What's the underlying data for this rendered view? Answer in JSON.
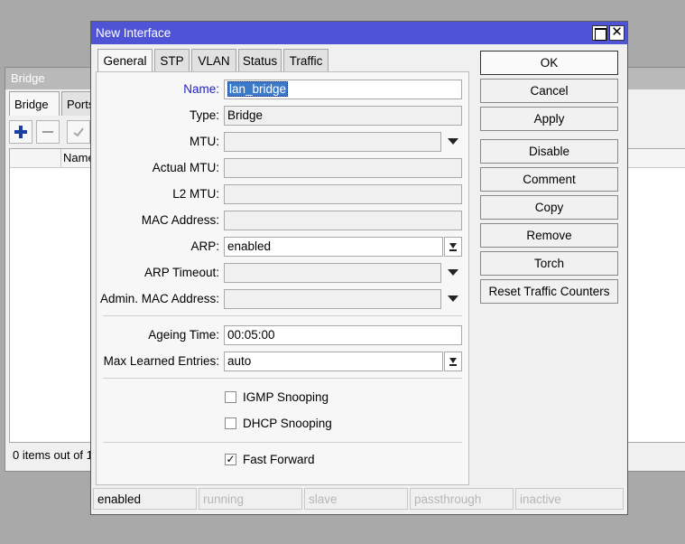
{
  "background_window": {
    "title": "Bridge",
    "tabs": [
      {
        "label": "Bridge",
        "active": true
      },
      {
        "label": "Ports",
        "active": false
      }
    ],
    "toolbar_icons": [
      "plus-icon",
      "minus-icon",
      "check-icon"
    ],
    "list_header": "Name",
    "status_text": "0 items out of 1"
  },
  "dialog": {
    "title": "New Interface",
    "tabs": [
      {
        "label": "General",
        "active": true
      },
      {
        "label": "STP",
        "active": false
      },
      {
        "label": "VLAN",
        "active": false
      },
      {
        "label": "Status",
        "active": false
      },
      {
        "label": "Traffic",
        "active": false
      }
    ],
    "fields": {
      "name": {
        "label": "Name:",
        "value": "lan_bridge"
      },
      "type": {
        "label": "Type:",
        "value": "Bridge"
      },
      "mtu": {
        "label": "MTU:",
        "value": ""
      },
      "actual_mtu": {
        "label": "Actual MTU:",
        "value": ""
      },
      "l2_mtu": {
        "label": "L2 MTU:",
        "value": ""
      },
      "mac_address": {
        "label": "MAC Address:",
        "value": ""
      },
      "arp": {
        "label": "ARP:",
        "value": "enabled"
      },
      "arp_timeout": {
        "label": "ARP Timeout:",
        "value": ""
      },
      "admin_mac": {
        "label": "Admin. MAC Address:",
        "value": ""
      },
      "ageing_time": {
        "label": "Ageing Time:",
        "value": "00:05:00"
      },
      "max_learned": {
        "label": "Max Learned Entries:",
        "value": "auto"
      }
    },
    "checkboxes": {
      "igmp": {
        "label": "IGMP Snooping",
        "checked": false
      },
      "dhcp": {
        "label": "DHCP Snooping",
        "checked": false
      },
      "fast_forward": {
        "label": "Fast Forward",
        "checked": true
      }
    },
    "buttons": {
      "ok": "OK",
      "cancel": "Cancel",
      "apply": "Apply",
      "disable": "Disable",
      "comment": "Comment",
      "copy": "Copy",
      "remove": "Remove",
      "torch": "Torch",
      "reset_traffic": "Reset Traffic Counters"
    },
    "status_bar": [
      "enabled",
      "running",
      "slave",
      "passthrough",
      "inactive"
    ]
  },
  "colors": {
    "title_bar": "#4f53d5",
    "name_label": "#1f1fc2",
    "selection": "#3b7ac9",
    "plus_icon": "#1a3fa0"
  }
}
